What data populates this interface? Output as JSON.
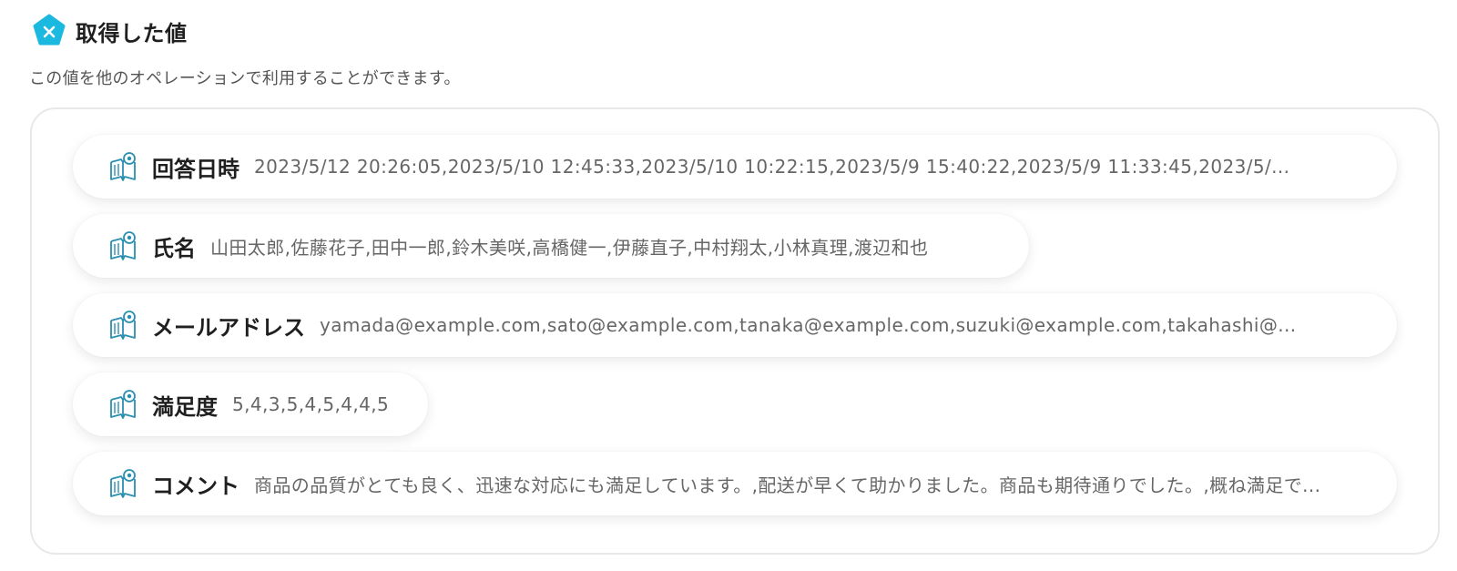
{
  "header": {
    "title": "取得した値",
    "logo_icon": "yoom-pentagon-icon",
    "brand_color": "#1bb8e0"
  },
  "description": "この値を他のオペレーションで利用することができます。",
  "values": [
    {
      "label": "回答日時",
      "value": "2023/5/12 20:26:05,2023/5/10 12:45:33,2023/5/10 10:22:15,2023/5/9 15:40:22,2023/5/9 11:33:45,2023/5/..."
    },
    {
      "label": "氏名",
      "value": "山田太郎,佐藤花子,田中一郎,鈴木美咲,高橋健一,伊藤直子,中村翔太,小林真理,渡辺和也"
    },
    {
      "label": "メールアドレス",
      "value": "yamada@example.com,sato@example.com,tanaka@example.com,suzuki@example.com,takahashi@..."
    },
    {
      "label": "満足度",
      "value": "5,4,3,5,4,5,4,4,5"
    },
    {
      "label": "コメント",
      "value": "商品の品質がとても良く、迅速な対応にも満足しています。,配送が早くて助かりました。商品も期待通りでした。,概ね満足で..."
    }
  ],
  "icon_color": "#2a8fb0"
}
